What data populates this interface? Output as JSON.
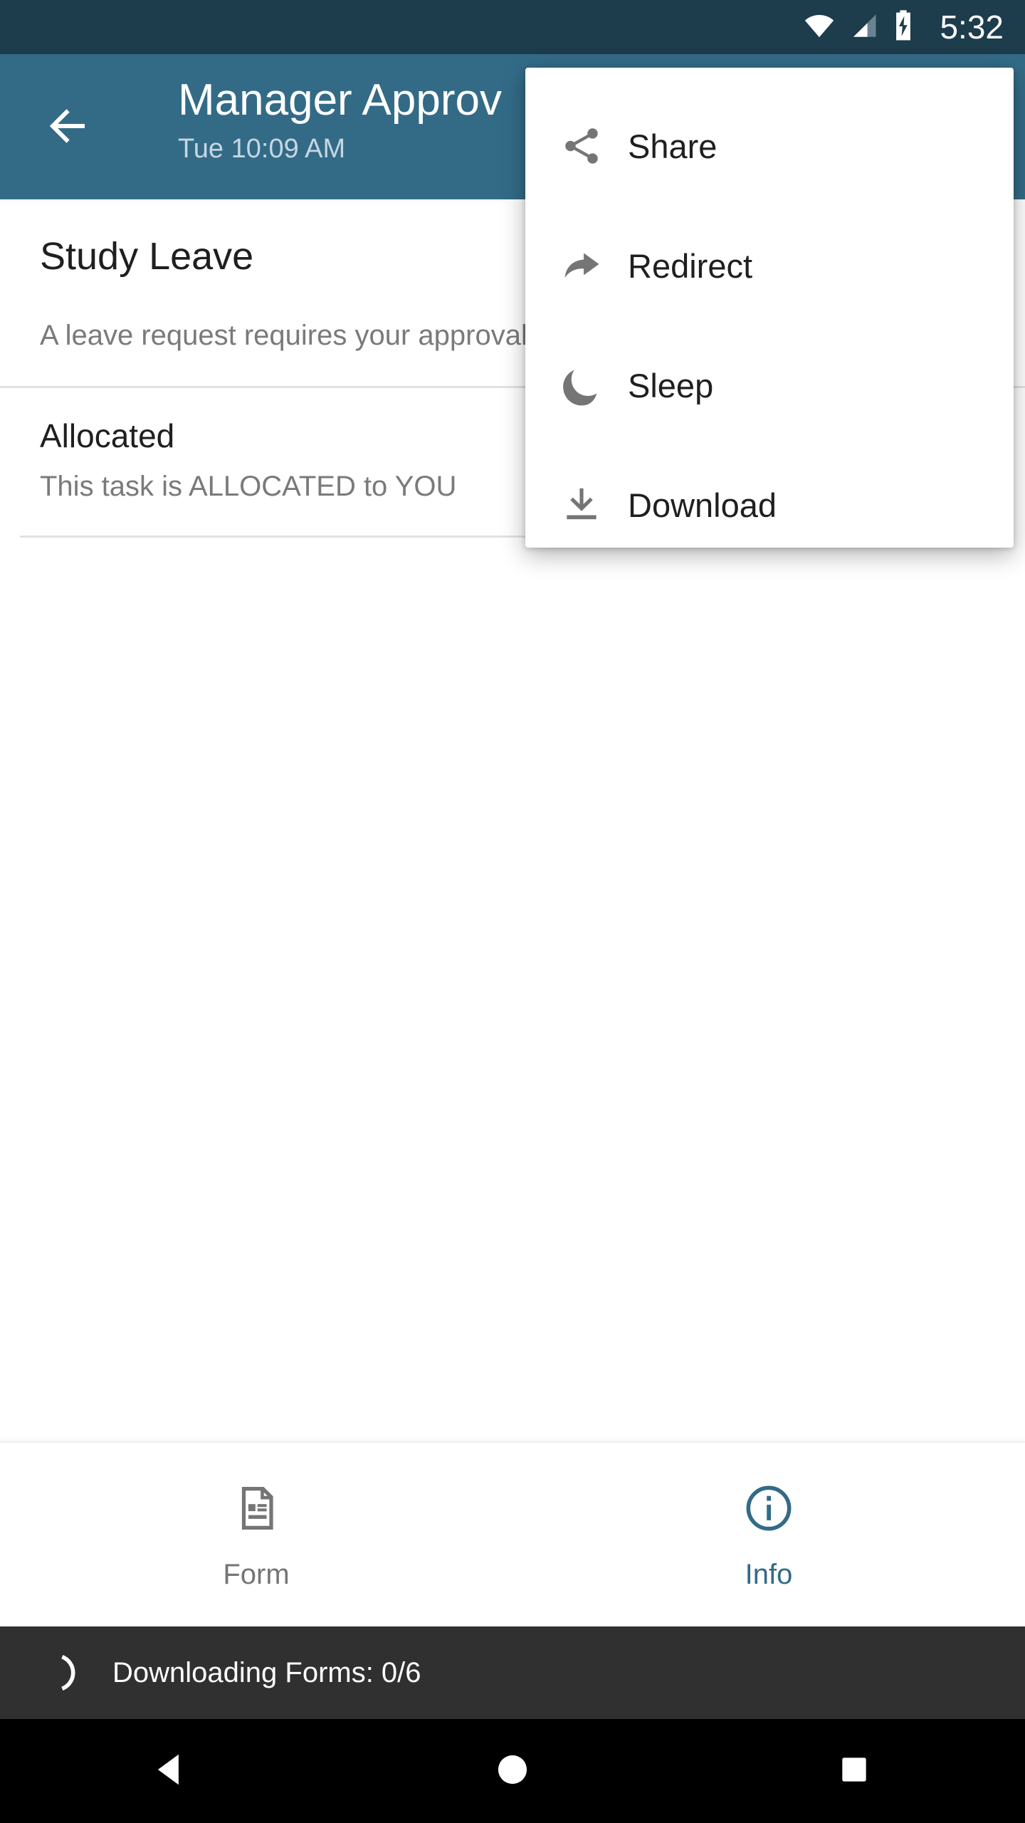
{
  "status_bar": {
    "time": "5:32",
    "icons": [
      "wifi-icon",
      "cellular-signal-icon",
      "battery-charging-icon"
    ]
  },
  "app_bar": {
    "back_icon": "arrow-left-icon",
    "title": "Manager Approv",
    "subtitle": "Tue 10:09 AM",
    "background_color": "#336b87"
  },
  "overflow_menu": {
    "visible": true,
    "items": [
      {
        "label": "Share",
        "icon": "share-icon"
      },
      {
        "label": "Redirect",
        "icon": "redirect-arrow-icon"
      },
      {
        "label": "Sleep",
        "icon": "moon-icon"
      },
      {
        "label": "Download",
        "icon": "download-icon"
      }
    ]
  },
  "content": {
    "request_title": "Study Leave",
    "request_description": "A leave request requires your approval, click Submit to send your decision",
    "status_title": "Allocated",
    "status_subtitle": "This task is ALLOCATED to YOU",
    "avatar_color": "#1e88e5"
  },
  "bottom_nav": {
    "tabs": [
      {
        "label": "Form",
        "icon": "form-document-icon",
        "active": false
      },
      {
        "label": "Info",
        "icon": "info-circle-icon",
        "active": true
      }
    ],
    "active_color": "#336b87",
    "inactive_color": "#757575"
  },
  "snackbar": {
    "text": "Downloading Forms: 0/6",
    "spinner_icon": "loading-spinner-icon",
    "background_color": "#303030"
  },
  "android_nav": {
    "buttons": [
      {
        "name": "back",
        "icon": "triangle-back-icon"
      },
      {
        "name": "home",
        "icon": "circle-home-icon"
      },
      {
        "name": "recents",
        "icon": "square-recents-icon"
      }
    ]
  }
}
